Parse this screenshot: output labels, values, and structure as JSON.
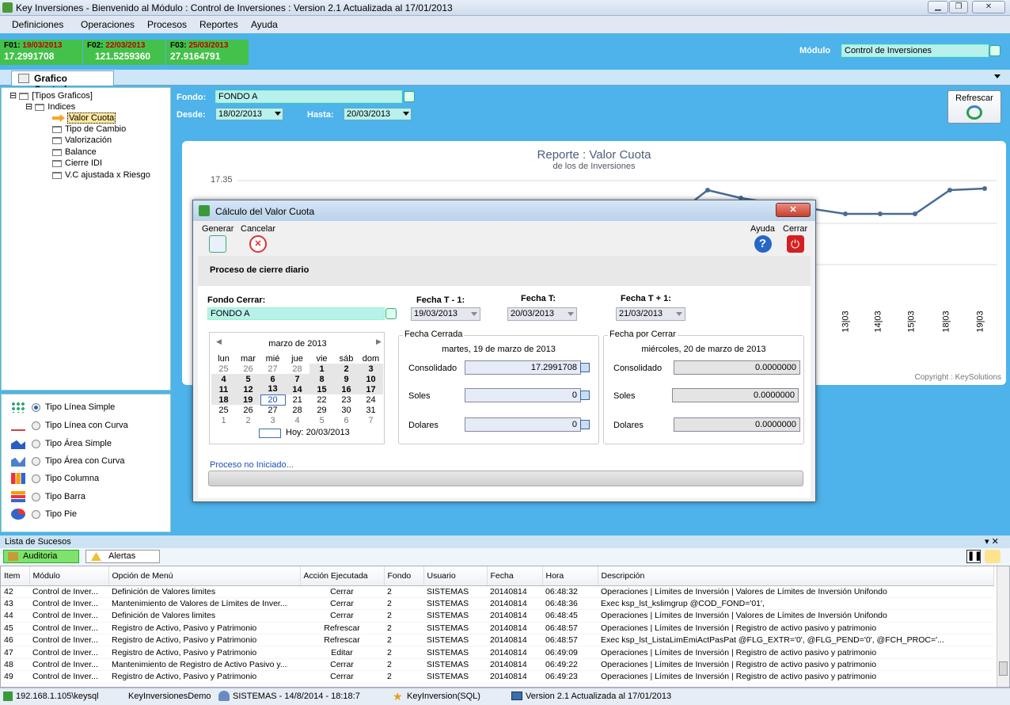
{
  "window": {
    "title": "Key Inversiones - Bienvenido al Módulo : Control de Inversiones : Version 2.1 Actualizada al 17/01/2013"
  },
  "menu": [
    "Definiciones",
    "Operaciones",
    "Procesos",
    "Reportes",
    "Ayuda"
  ],
  "fvalues": [
    {
      "label": "F01:",
      "date": "19/03/2013",
      "value": "17.2991708"
    },
    {
      "label": "F02:",
      "date": "22/03/2013",
      "value": "121.5259360"
    },
    {
      "label": "F03:",
      "date": "25/03/2013",
      "value": "27.9164791"
    }
  ],
  "modulo": {
    "label": "Módulo",
    "value": "Control de Inversiones"
  },
  "tab": {
    "label": "Grafico Centrales"
  },
  "tree": {
    "root": "[Tipos Graficos]",
    "group": "Indices",
    "items": [
      "Valor Cuota",
      "Tipo de Cambio",
      "Valorización",
      "Balance",
      "Cierre IDI",
      "V.C ajustada x Riesgo"
    ]
  },
  "chart_types": [
    {
      "label": "Tipo Línea Simple",
      "selected": true,
      "icon": "scatter-dots-icon"
    },
    {
      "label": "Tipo Línea con Curva",
      "selected": false,
      "icon": "line-curve-icon"
    },
    {
      "label": "Tipo Área Simple",
      "selected": false,
      "icon": "area-icon"
    },
    {
      "label": "Tipo Área  con Curva",
      "selected": false,
      "icon": "area-curve-icon"
    },
    {
      "label": "Tipo Columna",
      "selected": false,
      "icon": "column-chart-icon"
    },
    {
      "label": "Tipo Barra",
      "selected": false,
      "icon": "bar-chart-icon"
    },
    {
      "label": "Tipo Pie",
      "selected": false,
      "icon": "pie-chart-icon"
    }
  ],
  "filters": {
    "fondo_label": "Fondo:",
    "fondo_value": "FONDO A",
    "desde_label": "Desde:",
    "desde_value": "18/02/2013",
    "hasta_label": "Hasta:",
    "hasta_value": "20/03/2013",
    "refresh_label": "Refrescar"
  },
  "chart_data": {
    "type": "line",
    "title": "Reporte : Valor Cuota",
    "subtitle": "de los de Inversiones",
    "ytick": "17.35",
    "xticks": [
      "13|03",
      "14|03",
      "15|03",
      "18|03",
      "19|03"
    ],
    "copyright": "Copyright : KeySolutions",
    "visible_series": [
      {
        "x": [
          "-",
          "-",
          "13|03",
          "14|03",
          "15|03",
          "18|03",
          "19|03"
        ],
        "values": [
          17.35,
          17.33,
          17.31,
          17.31,
          17.31,
          17.35,
          17.35
        ]
      }
    ]
  },
  "dialog": {
    "title": "Cálculo del Valor Cuota",
    "toolbar": {
      "generar": "Generar",
      "cancelar": "Cancelar",
      "ayuda": "Ayuda",
      "cerrar": "Cerrar"
    },
    "header": "Proceso de cierre diario",
    "fondo_label": "Fondo Cerrar:",
    "fondo_value": "FONDO A",
    "fecha_t1_label": "Fecha T - 1:",
    "fecha_t1_value": "19/03/2013",
    "fecha_t_label": "Fecha T:",
    "fecha_t_value": "20/03/2013",
    "fecha_t2_label": "Fecha T + 1:",
    "fecha_t2_value": "21/03/2013",
    "calendar": {
      "month": "marzo de 2013",
      "days": [
        "lun",
        "mar",
        "mié",
        "jue",
        "vie",
        "sáb",
        "dom"
      ],
      "today": "Hoy: 20/03/2013"
    },
    "cerrada": {
      "title": "Fecha Cerrada",
      "date_text": "martes, 19 de marzo de 2013",
      "consolidado_label": "Consolidado",
      "consolidado": "17.2991708",
      "soles_label": "Soles",
      "soles": "0",
      "dolares_label": "Dolares",
      "dolares": "0"
    },
    "por_cerrar": {
      "title": "Fecha por Cerrar",
      "date_text": "miércoles, 20 de marzo de 2013",
      "consolidado_label": "Consolidado",
      "consolidado": "0.0000000",
      "soles_label": "Soles",
      "soles": "0.0000000",
      "dolares_label": "Dolares",
      "dolares": "0.0000000"
    },
    "status": "Proceso no Iniciado..."
  },
  "events": {
    "title": "Lista de Sucesos",
    "tabs": [
      "Auditoria",
      "Alertas"
    ],
    "pin": "▾ ✕",
    "columns": [
      "Item",
      "Módulo",
      "Opción de Menú",
      "Acción Ejecutada",
      "Fondo",
      "Usuario",
      "Fecha",
      "Hora",
      "Descripción"
    ],
    "rows": [
      [
        "42",
        "Control de Inver...",
        "Definición de Valores limites",
        "Cerrar",
        "2",
        "SISTEMAS",
        "20140814",
        "06:48:32",
        "Operaciones | Límites de Inversión | Valores de Límites de Inversión Unifondo"
      ],
      [
        "43",
        "Control de Inver...",
        "Mantenimiento de Valores de Límites de Inver...",
        "Cerrar",
        "2",
        "SISTEMAS",
        "20140814",
        "06:48:36",
        "Exec ksp_lst_kslimgrup @COD_FOND='01',"
      ],
      [
        "44",
        "Control de Inver...",
        "Definición de Valores limites",
        "Cerrar",
        "2",
        "SISTEMAS",
        "20140814",
        "06:48:45",
        "Operaciones | Límites de Inversión | Valores de Límites de Inversión Unifondo"
      ],
      [
        "45",
        "Control de Inver...",
        "Registro de Activo, Pasivo y Patrimonio",
        "Refrescar",
        "2",
        "SISTEMAS",
        "20140814",
        "06:48:57",
        "Operaciones | Límites de Inversión | Registro de activo pasivo y patrimonio"
      ],
      [
        "46",
        "Control de Inver...",
        "Registro de Activo, Pasivo y Patrimonio",
        "Refrescar",
        "2",
        "SISTEMAS",
        "20140814",
        "06:48:57",
        "Exec ksp_lst_ListaLimEmiActPasPat @FLG_EXTR='0', @FLG_PEND='0', @FCH_PROC='..."
      ],
      [
        "47",
        "Control de Inver...",
        "Registro de Activo, Pasivo y Patrimonio",
        "Editar",
        "2",
        "SISTEMAS",
        "20140814",
        "06:49:09",
        "Operaciones | Límites de Inversión | Registro de activo pasivo y patrimonio"
      ],
      [
        "48",
        "Control de Inver...",
        "Mantenimiento de Registro de Activo Pasivo y...",
        "Cerrar",
        "2",
        "SISTEMAS",
        "20140814",
        "06:49:22",
        "Operaciones | Límites de Inversión | Registro de activo pasivo y patrimonio"
      ],
      [
        "49",
        "Control de Inver...",
        "Registro de Activo, Pasivo y Patrimonio",
        "Cerrar",
        "2",
        "SISTEMAS",
        "20140814",
        "06:49:23",
        "Operaciones | Límites de Inversión | Registro de activo pasivo y patrimonio"
      ]
    ]
  },
  "statusbar": {
    "server": "192.168.1.105\\keysql",
    "db": "KeyInversionesDemo",
    "user": "SISTEMAS - 14/8/2014 - 18:18:7",
    "app": "KeyInversion(SQL)",
    "version": "Version 2.1 Actualizada al 17/01/2013"
  },
  "colors": {
    "background": "#4db3ea",
    "fbox": "#44c14a",
    "field": "#b8f0ec"
  }
}
